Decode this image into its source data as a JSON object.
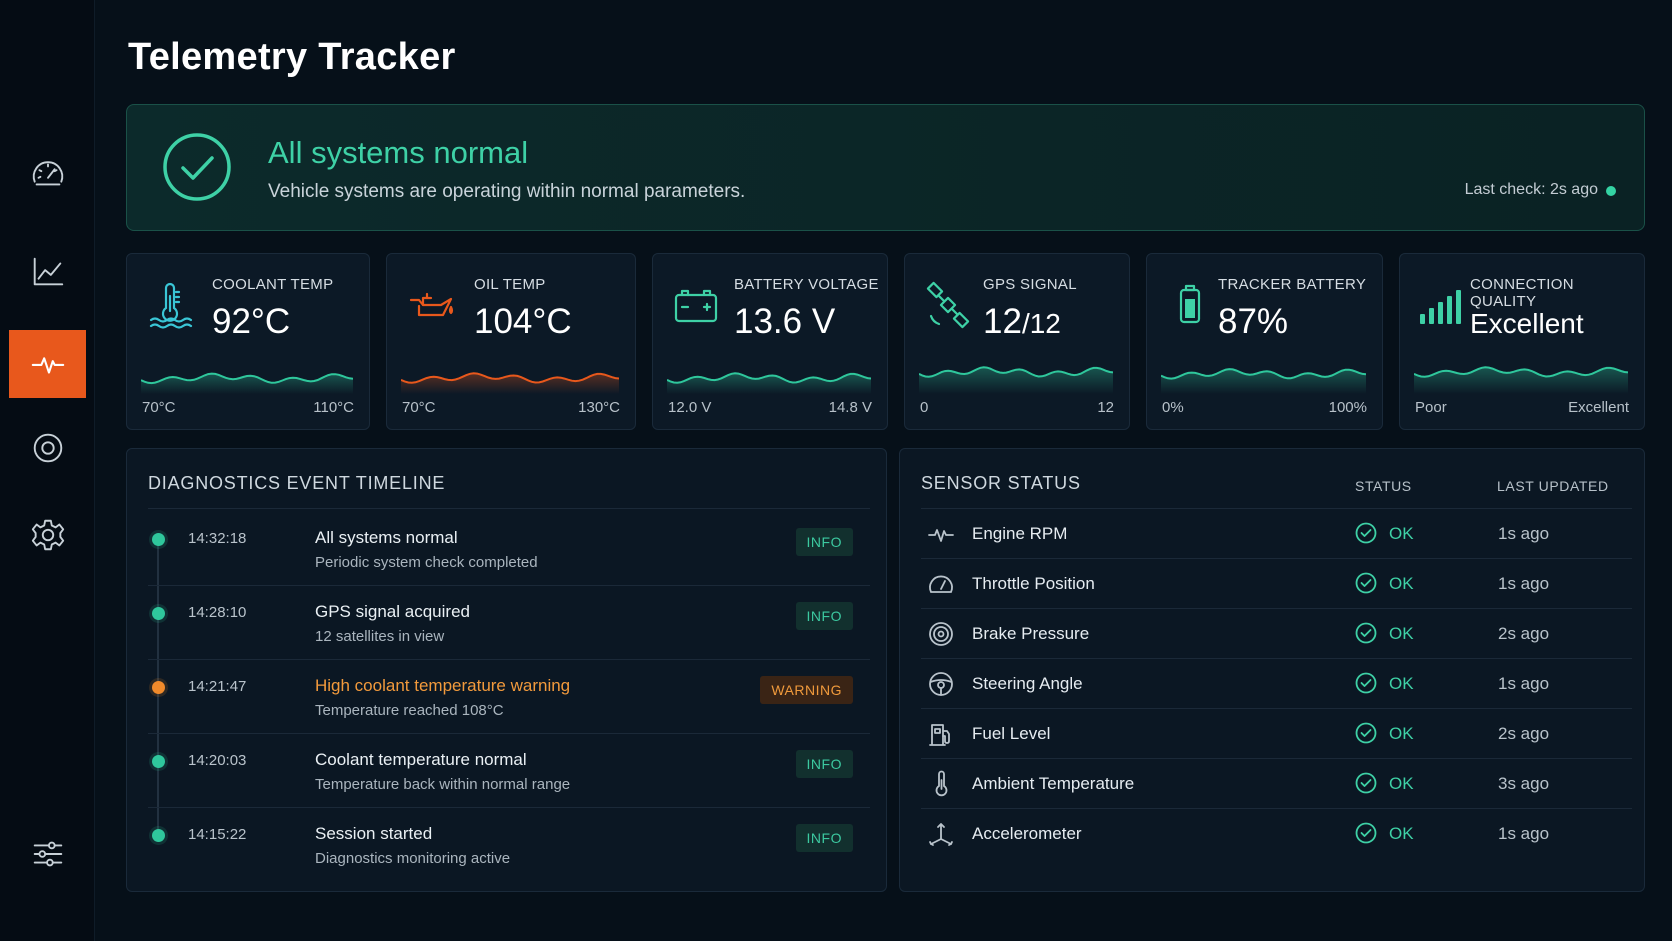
{
  "app": {
    "title": "Telemetry Tracker"
  },
  "nav": [
    {
      "name": "dashboard",
      "icon": "speedometer-icon"
    },
    {
      "name": "analytics",
      "icon": "line-chart-icon"
    },
    {
      "name": "diagnostics",
      "icon": "pulse-icon",
      "active": true
    },
    {
      "name": "target",
      "icon": "target-icon"
    },
    {
      "name": "settings",
      "icon": "gear-icon"
    },
    {
      "name": "filters",
      "icon": "sliders-icon"
    }
  ],
  "banner": {
    "title": "All systems normal",
    "subtitle": "Vehicle systems are operating within normal parameters.",
    "last_check": "Last check: 2s ago"
  },
  "metrics": [
    {
      "label": "COOLANT TEMP",
      "value": "92°C",
      "min": "70°C",
      "max": "110°C",
      "icon": "thermometer-icon",
      "color": "#2fc79c",
      "level": 0.55
    },
    {
      "label": "OIL TEMP",
      "value": "104°C",
      "min": "70°C",
      "max": "130°C",
      "icon": "oil-can-icon",
      "color": "#e8581c",
      "level": 0.57
    },
    {
      "label": "BATTERY VOLTAGE",
      "value": "13.6 V",
      "min": "12.0 V",
      "max": "14.8 V",
      "icon": "car-battery-icon",
      "color": "#2fc79c",
      "level": 0.57
    },
    {
      "label": "GPS SIGNAL",
      "value": "12",
      "value_suffix": "/12",
      "min": "0",
      "max": "12",
      "icon": "satellite-icon",
      "color": "#2fc79c",
      "level": 1.0
    },
    {
      "label": "TRACKER BATTERY",
      "value": "87%",
      "min": "0%",
      "max": "100%",
      "icon": "battery-icon",
      "color": "#2fc79c",
      "level": 0.87
    },
    {
      "label": "CONNECTION QUALITY",
      "value": "Excellent",
      "min": "Poor",
      "max": "Excellent",
      "icon": "signal-bars-icon",
      "color": "#2fc79c",
      "level": 1.0
    }
  ],
  "timeline": {
    "title": "DIAGNOSTICS EVENT TIMELINE",
    "events": [
      {
        "time": "14:32:18",
        "title": "All systems normal",
        "desc": "Periodic system check completed",
        "badge": "INFO",
        "level": "info"
      },
      {
        "time": "14:28:10",
        "title": "GPS signal acquired",
        "desc": "12 satellites in view",
        "badge": "INFO",
        "level": "info"
      },
      {
        "time": "14:21:47",
        "title": "High coolant temperature warning",
        "desc": "Temperature reached 108°C",
        "badge": "WARNING",
        "level": "warning"
      },
      {
        "time": "14:20:03",
        "title": "Coolant temperature normal",
        "desc": "Temperature back within normal range",
        "badge": "INFO",
        "level": "info"
      },
      {
        "time": "14:15:22",
        "title": "Session started",
        "desc": "Diagnostics monitoring active",
        "badge": "INFO",
        "level": "info"
      }
    ]
  },
  "sensors": {
    "title": "SENSOR STATUS",
    "col_status": "STATUS",
    "col_updated": "LAST UPDATED",
    "rows": [
      {
        "name": "Engine RPM",
        "status": "OK",
        "updated": "1s ago",
        "icon": "pulse-icon"
      },
      {
        "name": "Throttle Position",
        "status": "OK",
        "updated": "1s ago",
        "icon": "gauge-icon"
      },
      {
        "name": "Brake Pressure",
        "status": "OK",
        "updated": "2s ago",
        "icon": "brake-disc-icon"
      },
      {
        "name": "Steering Angle",
        "status": "OK",
        "updated": "1s ago",
        "icon": "steering-wheel-icon"
      },
      {
        "name": "Fuel Level",
        "status": "OK",
        "updated": "2s ago",
        "icon": "fuel-pump-icon"
      },
      {
        "name": "Ambient Temperature",
        "status": "OK",
        "updated": "3s ago",
        "icon": "thermometer-icon"
      },
      {
        "name": "Accelerometer",
        "status": "OK",
        "updated": "1s ago",
        "icon": "axes-icon"
      }
    ]
  },
  "colors": {
    "accent": "#e8581c",
    "ok": "#3ed1a6",
    "warning": "#f09a3c",
    "background": "#061019"
  }
}
